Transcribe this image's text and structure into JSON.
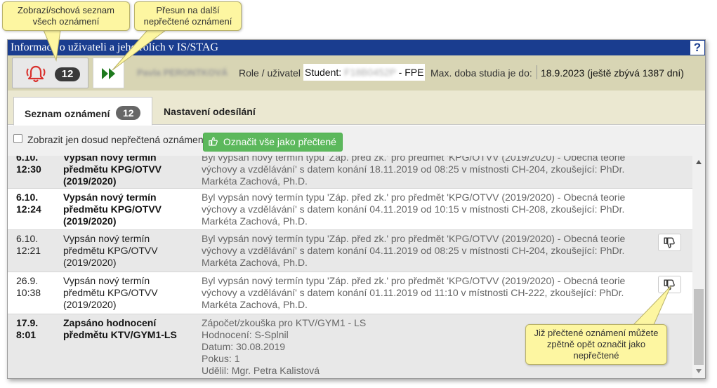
{
  "window": {
    "title": "Informace o uživateli a jeho rolích v IS/STAG",
    "help_label": "?"
  },
  "userbar": {
    "notification_count": "12",
    "user_name": "Pavla PERONTKOVÁ",
    "role_label": "Role / uživatel",
    "role_value_prefix": "Student:",
    "role_value_hidden": "F18B0452P",
    "role_value_suffix": "- FPE",
    "max_study_label": "Max. doba studia je do:",
    "max_study_value": "18.9.2023 (ještě zbývá 1387 dní)"
  },
  "tabs": [
    {
      "label": "Seznam oznámení",
      "badge": "12"
    },
    {
      "label": "Nastavení odesílání"
    }
  ],
  "toolbar": {
    "checkbox_label": "Zobrazit jen dosud nepřečtená oznámení",
    "mark_all_label": "Označit vše jako přečtené"
  },
  "notifications": [
    {
      "date": "6.10.",
      "time": "12:30",
      "title": "Vypsán nový termín předmětu KPG/OTVV (2019/2020)",
      "text": "Byl vypsán nový termín typu 'Záp. před zk.' pro předmět 'KPG/OTVV (2019/2020) - Obecná teorie výchovy a vzdělávání' s datem konání 18.11.2019 od 08:25 v místnosti CH-204, zkoušející: PhDr. Markéta Zachová, Ph.D.",
      "unread": true
    },
    {
      "date": "6.10.",
      "time": "12:24",
      "title": "Vypsán nový termín předmětu KPG/OTVV (2019/2020)",
      "text": "Byl vypsán nový termín typu 'Záp. před zk.' pro předmět 'KPG/OTVV (2019/2020) - Obecná teorie výchovy a vzdělávání' s datem konání 04.11.2019 od 10:15 v místnosti CH-208, zkoušející: PhDr. Markéta Zachová, Ph.D.",
      "unread": true
    },
    {
      "date": "6.10.",
      "time": "12:21",
      "title": "Vypsán nový termín předmětu KPG/OTVV (2019/2020)",
      "text": "Byl vypsán nový termín typu 'Záp. před zk.' pro předmět 'KPG/OTVV (2019/2020) - Obecná teorie výchovy a vzdělávání' s datem konání 04.11.2019 od 08:25 v místnosti CH-204, zkoušející: PhDr. Markéta Zachová, Ph.D.",
      "unread": false
    },
    {
      "date": "26.9.",
      "time": "10:38",
      "title": "Vypsán nový termín předmětu KPG/OTVV (2019/2020)",
      "text": "Byl vypsán nový termín typu 'Záp. před zk.' pro předmět 'KPG/OTVV (2019/2020) - Obecná teorie výchovy a vzdělávání' s datem konání 01.11.2019 od 11:10 v místnosti CH-222, zkoušející: PhDr. Markéta Zachová, Ph.D.",
      "unread": false
    },
    {
      "date": "17.9.",
      "time": "8:01",
      "title": "Zapsáno hodnocení předmětu KTV/GYM1-LS",
      "text_lines": [
        "Zápočet/zkouška pro KTV/GYM1 - LS",
        "Hodnocení: S-Splnil",
        "Datum: 30.08.2019",
        "Pokus: 1",
        "Udělil: Mgr. Petra Kalistová"
      ],
      "unread": true
    }
  ],
  "callouts": {
    "toggle_list": "Zobrazí/schová seznam všech oznámení",
    "next_unread": "Přesun na další nepřečtené oznámení",
    "mark_unread": "Již přečtené oznámení můžete zpětně opět označit jako nepřečtené"
  },
  "colors": {
    "title_bar": "#1a3d8f",
    "user_bar": "#d8d5b4",
    "tabs_bg": "#ebe8d1",
    "accent_green": "#5cb85c",
    "bell_red": "#d9302c",
    "callout_bg": "#fdf6a1"
  },
  "icons": [
    "bell-icon",
    "fast-forward-icon",
    "thumbs-up-icon",
    "thumbs-down-icon"
  ]
}
